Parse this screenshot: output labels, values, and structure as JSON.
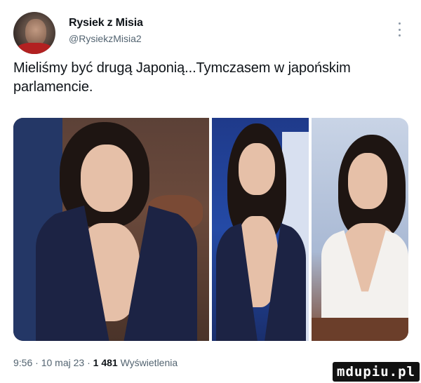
{
  "tweet": {
    "display_name": "Rysiek z Misia",
    "handle": "@RysiekzMisia2",
    "more_icon": "more-vertical-icon",
    "text_line1": "Mieliśmy być drugą Japonią...Tymczasem w japońskim",
    "text_line2": "parlamencie.",
    "photos": [
      "woman-navy-blazer",
      "woman-blue-backdrop",
      "woman-white-top"
    ]
  },
  "meta": {
    "time": "9:56",
    "separator1": " · ",
    "date": "10 maj 23",
    "separator2": " · ",
    "views_count": "1 481",
    "views_label": " Wyświetlenia"
  },
  "watermark": {
    "text": "mdupiu.pl"
  },
  "colors": {
    "text_primary": "#0f1419",
    "text_secondary": "#536471",
    "background": "#ffffff"
  }
}
